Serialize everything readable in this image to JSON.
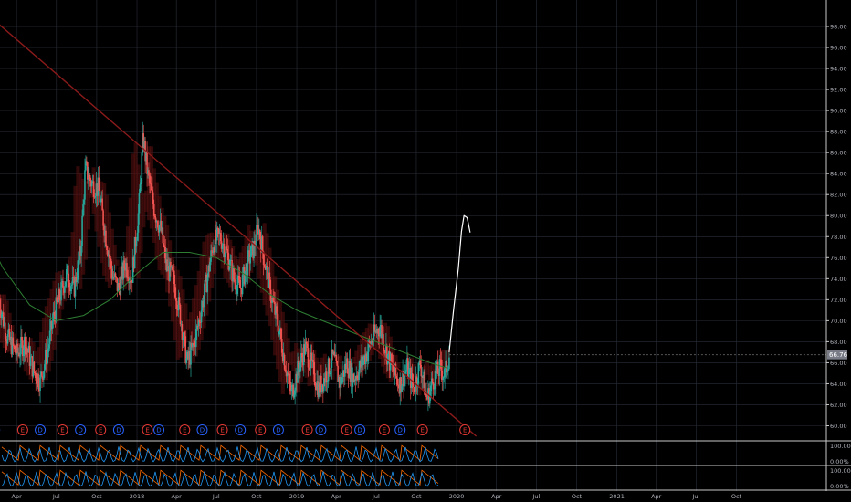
{
  "chart_data": {
    "type": "candlestick",
    "title": "",
    "xlabel": "",
    "ylabel": "",
    "ylim": [
      59,
      100
    ],
    "y_ticks": [
      60,
      62,
      64,
      66,
      68,
      70,
      72,
      74,
      76,
      78,
      80,
      82,
      84,
      86,
      88,
      90,
      92,
      94,
      96,
      98
    ],
    "y_tick_labels": [
      "60.00",
      "62.00",
      "64.00",
      "66.00",
      "68.00",
      "70.00",
      "72.00",
      "74.00",
      "76.00",
      "78.00",
      "80.00",
      "82.00",
      "84.00",
      "86.00",
      "88.00",
      "90.00",
      "92.00",
      "94.00",
      "96.00",
      "98.00"
    ],
    "x_tick_labels": [
      "Apr",
      "Jul",
      "Oct",
      "2018",
      "Apr",
      "Jul",
      "Oct",
      "2019",
      "Apr",
      "Jul",
      "Oct",
      "2020",
      "Apr",
      "Jul",
      "Oct",
      "2021",
      "Apr",
      "Jul",
      "Oct"
    ],
    "last_price": 66.76,
    "last_price_label": "66.76",
    "grid": true,
    "price_path": [
      [
        "2017-02-20",
        72.0
      ],
      [
        "2017-03-10",
        68.5
      ],
      [
        "2017-04-01",
        66.8
      ],
      [
        "2017-04-20",
        68.0
      ],
      [
        "2017-05-10",
        65.2
      ],
      [
        "2017-05-25",
        64.3
      ],
      [
        "2017-06-10",
        67.0
      ],
      [
        "2017-06-25",
        70.5
      ],
      [
        "2017-07-10",
        72.5
      ],
      [
        "2017-07-25",
        74.5
      ],
      [
        "2017-08-10",
        73.0
      ],
      [
        "2017-08-25",
        76.5
      ],
      [
        "2017-09-05",
        84.5
      ],
      [
        "2017-09-20",
        83.0
      ],
      [
        "2017-10-05",
        82.5
      ],
      [
        "2017-10-20",
        78.5
      ],
      [
        "2017-11-05",
        74.5
      ],
      [
        "2017-11-20",
        73.0
      ],
      [
        "2017-12-05",
        75.5
      ],
      [
        "2017-12-20",
        74.0
      ],
      [
        "2018-01-05",
        80.5
      ],
      [
        "2018-01-15",
        87.5
      ],
      [
        "2018-01-25",
        84.0
      ],
      [
        "2018-02-10",
        80.5
      ],
      [
        "2018-02-25",
        78.5
      ],
      [
        "2018-03-10",
        75.0
      ],
      [
        "2018-03-25",
        74.0
      ],
      [
        "2018-04-10",
        70.5
      ],
      [
        "2018-04-25",
        66.0
      ],
      [
        "2018-05-10",
        67.5
      ],
      [
        "2018-05-25",
        70.5
      ],
      [
        "2018-06-10",
        74.0
      ],
      [
        "2018-06-25",
        77.5
      ],
      [
        "2018-07-10",
        78.0
      ],
      [
        "2018-07-25",
        76.5
      ],
      [
        "2018-08-10",
        74.0
      ],
      [
        "2018-08-25",
        73.0
      ],
      [
        "2018-09-10",
        75.5
      ],
      [
        "2018-09-25",
        77.0
      ],
      [
        "2018-10-05",
        79.0
      ],
      [
        "2018-10-20",
        75.5
      ],
      [
        "2018-11-05",
        72.0
      ],
      [
        "2018-11-20",
        69.5
      ],
      [
        "2018-12-05",
        66.0
      ],
      [
        "2018-12-20",
        63.0
      ],
      [
        "2019-01-05",
        65.5
      ],
      [
        "2019-01-20",
        67.5
      ],
      [
        "2019-02-05",
        65.5
      ],
      [
        "2019-02-20",
        63.5
      ],
      [
        "2019-03-10",
        65.0
      ],
      [
        "2019-03-25",
        66.5
      ],
      [
        "2019-04-10",
        64.0
      ],
      [
        "2019-04-25",
        66.0
      ],
      [
        "2019-05-10",
        64.5
      ],
      [
        "2019-05-25",
        65.5
      ],
      [
        "2019-06-10",
        67.0
      ],
      [
        "2019-06-25",
        68.5
      ],
      [
        "2019-07-10",
        69.5
      ],
      [
        "2019-07-25",
        67.0
      ],
      [
        "2019-08-10",
        65.0
      ],
      [
        "2019-08-25",
        64.0
      ],
      [
        "2019-09-10",
        65.5
      ],
      [
        "2019-09-25",
        63.5
      ],
      [
        "2019-10-10",
        66.0
      ],
      [
        "2019-10-25",
        62.5
      ],
      [
        "2019-11-10",
        64.5
      ],
      [
        "2019-11-25",
        65.5
      ],
      [
        "2019-12-05",
        64.8
      ],
      [
        "2019-12-15",
        66.76
      ]
    ],
    "ma_path": [
      [
        "2017-01-01",
        80.0
      ],
      [
        "2017-03-01",
        75.0
      ],
      [
        "2017-05-01",
        71.5
      ],
      [
        "2017-07-01",
        70.0
      ],
      [
        "2017-09-01",
        70.5
      ],
      [
        "2017-11-01",
        72.0
      ],
      [
        "2018-01-01",
        74.5
      ],
      [
        "2018-03-01",
        76.5
      ],
      [
        "2018-05-01",
        76.5
      ],
      [
        "2018-07-01",
        76.0
      ],
      [
        "2018-09-01",
        74.5
      ],
      [
        "2018-11-01",
        72.5
      ],
      [
        "2019-01-01",
        71.0
      ],
      [
        "2019-03-01",
        70.0
      ],
      [
        "2019-05-01",
        69.0
      ],
      [
        "2019-07-01",
        68.0
      ],
      [
        "2019-09-01",
        67.0
      ],
      [
        "2019-11-01",
        66.0
      ],
      [
        "2019-12-10",
        65.5
      ]
    ],
    "trendline": {
      "start": [
        "2017-01-01",
        100.0
      ],
      "end": [
        "2020-02-15",
        59.0
      ]
    },
    "projection_path": [
      [
        "2019-12-15",
        67.0
      ],
      [
        "2019-12-25",
        71.0
      ],
      [
        "2020-01-05",
        75.0
      ],
      [
        "2020-01-12",
        78.5
      ],
      [
        "2020-01-18",
        80.0
      ],
      [
        "2020-01-25",
        79.8
      ],
      [
        "2020-02-01",
        78.4
      ]
    ],
    "event_markers": [
      {
        "label": "E",
        "date": "2017-01-15",
        "kind": "earnings"
      },
      {
        "label": "D",
        "date": "2017-02-10",
        "kind": "dividend"
      },
      {
        "label": "E",
        "date": "2017-04-15",
        "kind": "earnings"
      },
      {
        "label": "D",
        "date": "2017-05-25",
        "kind": "dividend"
      },
      {
        "label": "E",
        "date": "2017-07-15",
        "kind": "earnings"
      },
      {
        "label": "D",
        "date": "2017-08-25",
        "kind": "dividend"
      },
      {
        "label": "E",
        "date": "2017-10-10",
        "kind": "earnings"
      },
      {
        "label": "D",
        "date": "2017-11-20",
        "kind": "dividend"
      },
      {
        "label": "E",
        "date": "2018-01-25",
        "kind": "earnings"
      },
      {
        "label": "D",
        "date": "2018-02-20",
        "kind": "dividend"
      },
      {
        "label": "E",
        "date": "2018-04-20",
        "kind": "earnings"
      },
      {
        "label": "D",
        "date": "2018-05-30",
        "kind": "dividend"
      },
      {
        "label": "E",
        "date": "2018-07-15",
        "kind": "earnings"
      },
      {
        "label": "D",
        "date": "2018-08-25",
        "kind": "dividend"
      },
      {
        "label": "E",
        "date": "2018-10-10",
        "kind": "earnings"
      },
      {
        "label": "D",
        "date": "2018-11-20",
        "kind": "dividend"
      },
      {
        "label": "E",
        "date": "2019-01-25",
        "kind": "earnings"
      },
      {
        "label": "D",
        "date": "2019-02-25",
        "kind": "dividend"
      },
      {
        "label": "E",
        "date": "2019-04-25",
        "kind": "earnings"
      },
      {
        "label": "D",
        "date": "2019-05-25",
        "kind": "dividend"
      },
      {
        "label": "E",
        "date": "2019-07-20",
        "kind": "earnings"
      },
      {
        "label": "D",
        "date": "2019-08-25",
        "kind": "dividend"
      },
      {
        "label": "E",
        "date": "2019-10-15",
        "kind": "earnings"
      },
      {
        "label": "E",
        "date": "2020-01-20",
        "kind": "earnings"
      }
    ],
    "indicator_panes": [
      {
        "top_label": "100.00%",
        "bottom_label": "0.00%"
      },
      {
        "top_label": "100.00%",
        "bottom_label": "0.00%"
      }
    ],
    "colors": {
      "background": "#000000",
      "grid": "#2a2e39",
      "up": "#26a69a",
      "down": "#ef5350",
      "ma": "#2e7d32",
      "trendline": "#8b1a1a",
      "cloud": "#5a1010",
      "projection": "#ffffff",
      "dividend": "#2962ff",
      "earnings": "#e53935",
      "axis_text": "#b2b5be",
      "osc_blue": "#2196f3",
      "osc_orange": "#ff6d00"
    }
  }
}
